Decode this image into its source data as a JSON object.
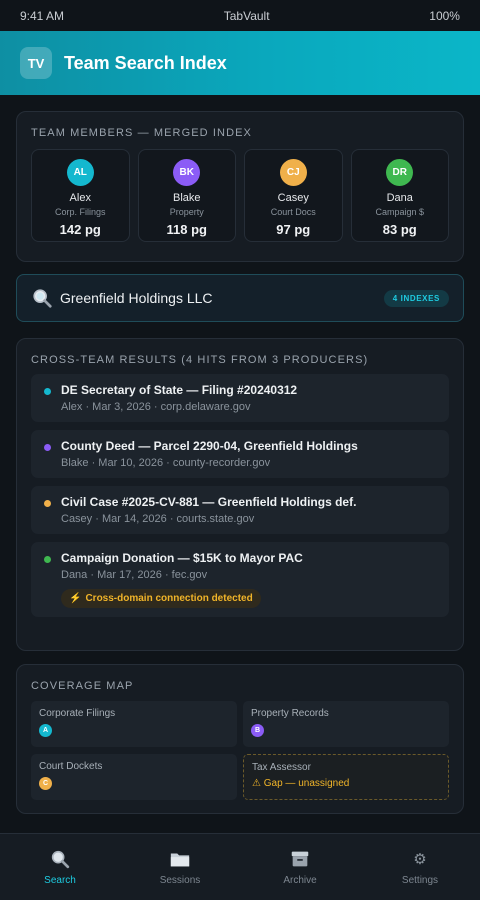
{
  "status_bar": {
    "time": "9:41 AM",
    "carrier": "TabVault",
    "battery": "100%"
  },
  "header": {
    "logo_text": "TV",
    "title": "Team Search Index"
  },
  "team": {
    "label": "TEAM MEMBERS — MERGED INDEX",
    "members": [
      {
        "initials": "AL",
        "name": "Alex",
        "domain": "Corp. Filings",
        "pages": "142 pg",
        "color": "#14b8cf"
      },
      {
        "initials": "BK",
        "name": "Blake",
        "domain": "Property",
        "pages": "118 pg",
        "color": "#8b5cf6"
      },
      {
        "initials": "CJ",
        "name": "Casey",
        "domain": "Court Docs",
        "pages": "97 pg",
        "color": "#f0b04a"
      },
      {
        "initials": "DR",
        "name": "Dana",
        "domain": "Campaign $",
        "pages": "83 pg",
        "color": "#3fb850"
      }
    ]
  },
  "search": {
    "query": "Greenfield Holdings LLC",
    "badge": "4 INDEXES"
  },
  "results": {
    "label": "CROSS-TEAM RESULTS (4 HITS FROM 3 PRODUCERS)",
    "items": [
      {
        "title": "DE Secretary of State — Filing #20240312",
        "meta": "Alex · Mar 3, 2026 · corp.delaware.gov",
        "color": "#14b8cf"
      },
      {
        "title": "County Deed — Parcel 2290-04, Greenfield Holdings",
        "meta": "Blake · Mar 10, 2026 · county-recorder.gov",
        "color": "#8b5cf6"
      },
      {
        "title": "Civil Case #2025-CV-881 — Greenfield Holdings def.",
        "meta": "Casey · Mar 14, 2026 · courts.state.gov",
        "color": "#f0b04a"
      },
      {
        "title": "Campaign Donation — $15K to Mayor PAC",
        "meta": "Dana · Mar 17, 2026 · fec.gov",
        "color": "#3fb850",
        "alert": "Cross-domain connection detected"
      }
    ]
  },
  "coverage": {
    "label": "COVERAGE MAP",
    "cells": [
      {
        "name": "Corporate Filings",
        "badge": "A",
        "color": "#14b8cf"
      },
      {
        "name": "Property Records",
        "badge": "B",
        "color": "#8b5cf6"
      },
      {
        "name": "Court Dockets",
        "badge": "C",
        "color": "#f0b04a"
      },
      {
        "name": "Tax Assessor",
        "gap": "⚠ Gap — unassigned"
      }
    ]
  },
  "nav": [
    {
      "label": "Search",
      "icon": "search-icon"
    },
    {
      "label": "Sessions",
      "icon": "folder-icon"
    },
    {
      "label": "Archive",
      "icon": "archive-icon"
    },
    {
      "label": "Settings",
      "icon": "gear-icon"
    }
  ],
  "colors": {
    "accent": "#1ecbe0",
    "warning": "#f0b429"
  }
}
